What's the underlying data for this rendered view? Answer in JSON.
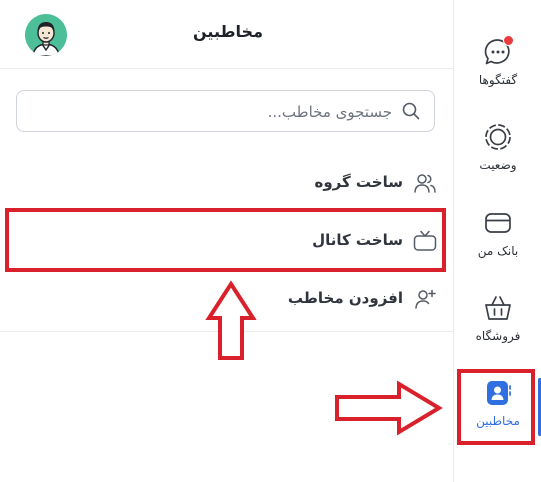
{
  "header": {
    "title": "مخاطبین"
  },
  "search": {
    "placeholder": "جستجوی مخاطب..."
  },
  "menu": {
    "items": [
      {
        "label": "ساخت گروه",
        "icon": "group-icon"
      },
      {
        "label": "ساخت کانال",
        "icon": "tv-channel-icon"
      },
      {
        "label": "افزودن مخاطب",
        "icon": "add-user-icon"
      }
    ]
  },
  "rail": {
    "items": [
      {
        "label": "گفتگوها",
        "icon": "chat-bubble-icon",
        "has_badge": true
      },
      {
        "label": "وضعیت",
        "icon": "status-ring-icon"
      },
      {
        "label": "بانک من",
        "icon": "card-icon"
      },
      {
        "label": "فروشگاه",
        "icon": "basket-icon"
      },
      {
        "label": "مخاطبین",
        "icon": "contacts-icon",
        "active": true
      }
    ]
  },
  "colors": {
    "accent": "#2f6fe0",
    "highlight": "#d8212a",
    "badge": "#ea3c3c",
    "avatar_bg": "#4cbf98"
  }
}
